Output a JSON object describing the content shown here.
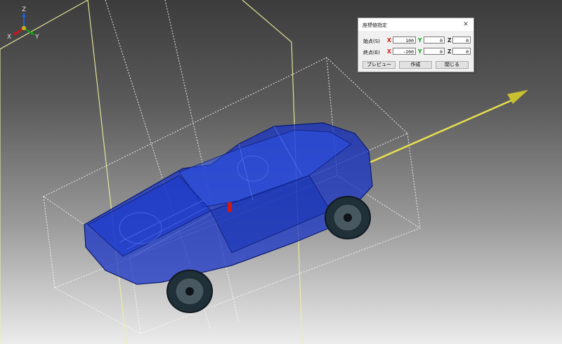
{
  "viewport": {
    "triad": {
      "x": "X",
      "y": "Y",
      "z": "Z"
    }
  },
  "dialog": {
    "title": "座標値指定",
    "close_glyph": "✕",
    "rows": [
      {
        "label": "始点(S)",
        "x_label": "X",
        "x": "100",
        "y_label": "Y",
        "y": "0",
        "z_label": "Z",
        "z": "0"
      },
      {
        "label": "終点(E)",
        "x_label": "X",
        "x": "-200",
        "y_label": "Y",
        "y": "0",
        "z_label": "Z",
        "z": "0"
      }
    ],
    "buttons": {
      "preview": "プレビュー",
      "create": "作成",
      "close": "閉じる"
    }
  },
  "colors": {
    "direction_arrow": "#e8e050",
    "frame_lines": "#f2f2a0",
    "bounding_box": "#ffffff",
    "model_body": "#1530c8",
    "axis_x": "#e01010",
    "axis_y": "#10a010",
    "axis_z": "#1a60e0"
  },
  "icons": {
    "axis_triad": "axis-triad-icon",
    "close": "close-icon"
  }
}
